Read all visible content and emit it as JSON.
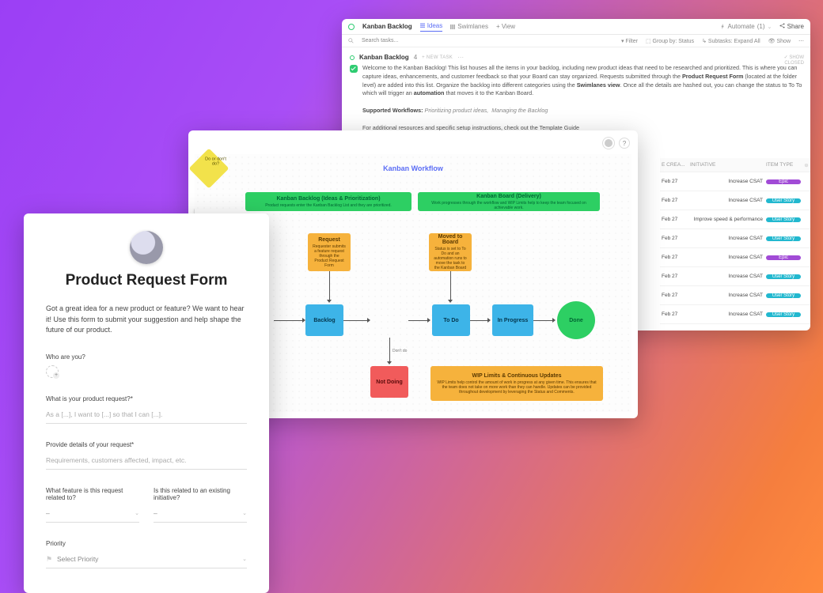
{
  "backlog": {
    "title": "Kanban Backlog",
    "tabs": {
      "ideas": "Ideas",
      "swimlanes": "Swimlanes",
      "add_view": "+ View"
    },
    "automate": "Automate",
    "automate_count": "(1)",
    "share": "Share",
    "toolbar": {
      "search": "Search tasks...",
      "filter": "Filter",
      "groupby": "Group by: Status",
      "subtasks": "Subtasks: Expand All",
      "show": "Show"
    },
    "list_name": "Kanban Backlog",
    "task_count": "4",
    "new_task": "+ NEW TASK",
    "show_closed_1": "SHOW",
    "show_closed_2": "CLOSED",
    "desc": {
      "welcome": "Welcome to the Kanban Backlog! This list houses all the items in your backlog, including new product ideas that need to be researched and prioritized. This is where you can capture ideas, enhancements, and customer feedback so that your Board can stay organized. Requests submitted through the ",
      "link1": "Product Request Form",
      "cont1": " (located at the folder level) are added into this list. Organize the backlog into different categories using the ",
      "link2": "Swimlanes view",
      "cont2": ". Once all the details are hashed out, you can change the status to To To which will trigger an ",
      "link3": "automation",
      "cont3": " that moves it to the Kanban Board.",
      "supported_label": "Supported Workflows:",
      "supported_1": "Prioritizing product ideas,",
      "supported_2": "Managing the Backlog",
      "footer": "For additional resources and specific setup instructions, check out the Template Guide"
    },
    "columns": {
      "created": "E CREA...",
      "initiative": "INITIATIVE",
      "itemtype": "ITEM TYPE"
    },
    "rows": [
      {
        "date": "Feb 27",
        "initiative": "Increase CSAT",
        "type": "Epic"
      },
      {
        "date": "Feb 27",
        "initiative": "Increase CSAT",
        "type": "User Story"
      },
      {
        "date": "Feb 27",
        "initiative": "Improve speed & performance",
        "type": "User Story"
      },
      {
        "date": "Feb 27",
        "initiative": "Increase CSAT",
        "type": "User Story"
      },
      {
        "date": "Feb 27",
        "initiative": "Increase CSAT",
        "type": "Epic"
      },
      {
        "date": "Feb 27",
        "initiative": "Increase CSAT",
        "type": "User Story"
      },
      {
        "date": "Feb 27",
        "initiative": "Increase CSAT",
        "type": "User Story"
      },
      {
        "date": "Feb 27",
        "initiative": "Increase CSAT",
        "type": "User Story"
      }
    ]
  },
  "workflow": {
    "title": "Kanban Workflow",
    "head1_t": "Kanban Backlog (Ideas & Prioritization)",
    "head1_s": "Product requests enter the Kanban Backlog List and they are prioritized.",
    "head2_t": "Kanban Board (Delivery)",
    "head2_s": "Work progresses through the workflow and WIP Limits help to keep the team focused on achievable work.",
    "request_t": "Request",
    "request_s": "Requester submits a feature request through the Product Request Form",
    "moved_t": "Moved to Board",
    "moved_s": "Status is set to To Do and an automation runs to move the task to the Kanban Board",
    "backlog_t": "Backlog",
    "diamond": "Do or don't do?",
    "todo_t": "To Do",
    "inprog_t": "In Progress",
    "done_t": "Done",
    "notdoing_t": "Not Doing",
    "dontdo": "Don't do",
    "wip_t": "WIP Limits & Continuous Updates",
    "wip_s": "WIP Limits help control the amount of work in progress at any given time. This ensures that the team does not take on more work than they can handle. Updates can be provided throughout development by leveraging the Status and Comments."
  },
  "form": {
    "title": "Product Request Form",
    "intro": "Got a great idea for a new product or feature? We want to hear it! Use this form to submit your suggestion and help shape the future of our product.",
    "who_label": "Who are you?",
    "req_label": "What is your product request?*",
    "req_placeholder": "As a [...], I want to [...] so that I can [...].",
    "details_label": "Provide details of your request*",
    "details_placeholder": "Requirements, customers affected, impact, etc.",
    "feature_label": "What feature is this request related to?",
    "initiative_label": "Is this related to an existing initiative?",
    "dash": "–",
    "priority_label": "Priority",
    "priority_placeholder": "Select Priority"
  }
}
